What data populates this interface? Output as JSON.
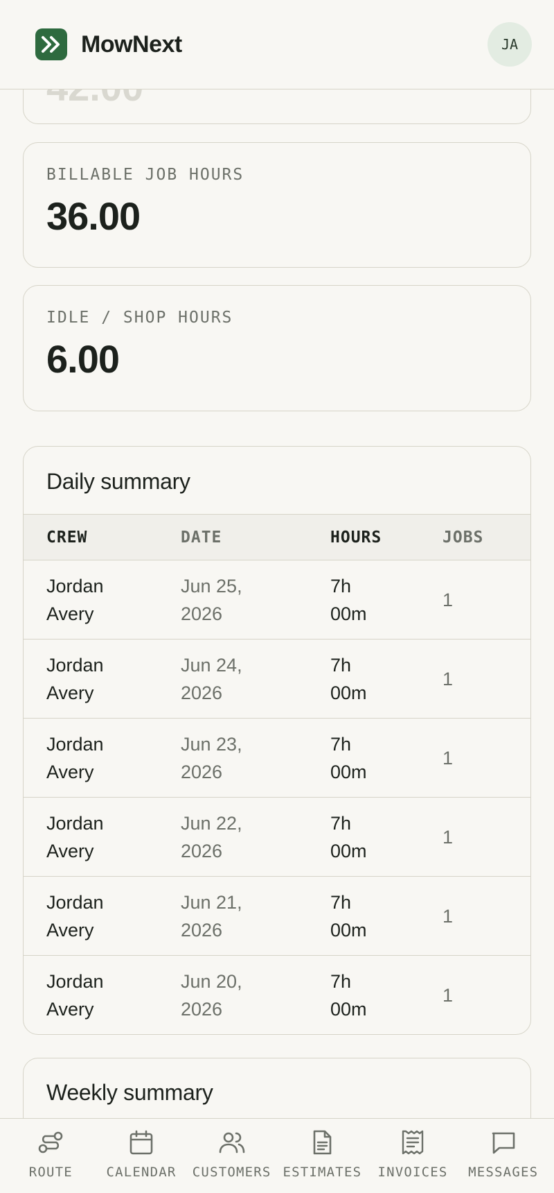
{
  "app": {
    "name": "MowNext",
    "user_initials": "JA"
  },
  "cards": {
    "previous_partial_value": "42.00",
    "billable": {
      "label": "BILLABLE JOB HOURS",
      "value": "36.00"
    },
    "idle": {
      "label": "IDLE / SHOP HOURS",
      "value": "6.00"
    }
  },
  "daily_summary": {
    "title": "Daily summary",
    "columns": [
      "CREW",
      "DATE",
      "HOURS",
      "JOBS"
    ],
    "rows": [
      {
        "crew": "Jordan Avery",
        "date": "Jun 25, 2026",
        "hours": "7h 00m",
        "jobs": "1"
      },
      {
        "crew": "Jordan Avery",
        "date": "Jun 24, 2026",
        "hours": "7h 00m",
        "jobs": "1"
      },
      {
        "crew": "Jordan Avery",
        "date": "Jun 23, 2026",
        "hours": "7h 00m",
        "jobs": "1"
      },
      {
        "crew": "Jordan Avery",
        "date": "Jun 22, 2026",
        "hours": "7h 00m",
        "jobs": "1"
      },
      {
        "crew": "Jordan Avery",
        "date": "Jun 21, 2026",
        "hours": "7h 00m",
        "jobs": "1"
      },
      {
        "crew": "Jordan Avery",
        "date": "Jun 20, 2026",
        "hours": "7h 00m",
        "jobs": "1"
      }
    ]
  },
  "weekly_summary": {
    "title": "Weekly summary"
  },
  "nav": {
    "items": [
      {
        "label": "ROUTE",
        "icon": "route-icon"
      },
      {
        "label": "CALENDAR",
        "icon": "calendar-icon"
      },
      {
        "label": "CUSTOMERS",
        "icon": "customers-icon"
      },
      {
        "label": "ESTIMATES",
        "icon": "estimates-icon"
      },
      {
        "label": "INVOICES",
        "icon": "invoices-icon"
      },
      {
        "label": "MESSAGES",
        "icon": "messages-icon"
      }
    ]
  },
  "colors": {
    "brand": "#2e6a3f",
    "border": "#d6d4c8",
    "background": "#f8f7f3",
    "muted": "#6c7069"
  }
}
